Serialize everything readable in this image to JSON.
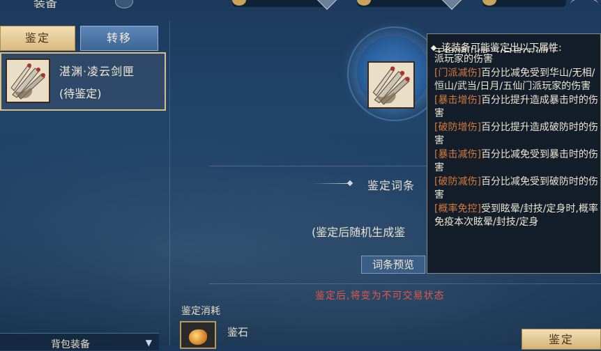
{
  "top": {
    "title": "装备",
    "currencies": [
      {
        "name": "gold"
      },
      {
        "name": "silver"
      },
      {
        "name": "coin"
      }
    ]
  },
  "tabs": {
    "identify": "鉴定",
    "transfer": "转移"
  },
  "equipment": {
    "name": "湛渊·凌云剑匣",
    "status": "(待鉴定)",
    "icon": "sword-case-icon"
  },
  "bag": {
    "label": "背包装备"
  },
  "center": {
    "entry_title": "鉴定词条",
    "random_note": "(鉴定后随机生成鉴",
    "preview_button": "词条预览",
    "trade_warning": "鉴定后,将变为不可交易状态",
    "cost_title": "鉴定消耗",
    "stone_name": "鉴石",
    "identify_button": "鉴定"
  },
  "tooltip": {
    "header": "该装备可能鉴定出以下属性:",
    "partial_line": "无相/恒山/武当/日月/五仙门",
    "lines_top": [
      "派玩家的伤害"
    ],
    "entries": [
      {
        "tag": "[门派减伤]",
        "text": "百分比减免受到华山/无相/恒山/武当/日月/五仙门派玩家的伤害"
      },
      {
        "tag": "[暴击增伤]",
        "text": "百分比提升造成暴击时的伤害"
      },
      {
        "tag": "[破防增伤]",
        "text": "百分比提升造成破防时的伤害"
      },
      {
        "tag": "[暴击减伤]",
        "text": "百分比减免受到暴击时的伤害"
      },
      {
        "tag": "[破防减伤]",
        "text": "百分比减免受到破防时的伤害"
      },
      {
        "tag": "[概率免控]",
        "text": "受到眩晕/封技/定身时,概率免疫本次眩晕/封技/定身"
      }
    ]
  },
  "colors": {
    "accent_gold": "#d7bf86",
    "tag_orange": "#d47a3c",
    "warning_red": "#e0564a"
  }
}
